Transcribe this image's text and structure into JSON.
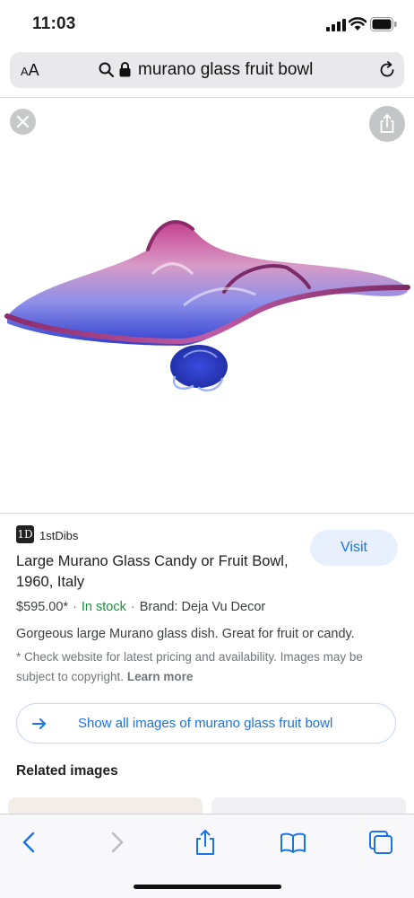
{
  "status": {
    "time": "11:03"
  },
  "address_bar": {
    "aa_label": "AA",
    "url_text": "murano glass fruit bowl"
  },
  "result": {
    "source_logo_text": "1D",
    "source_name": "1stDibs",
    "visit_label": "Visit",
    "title": "Large Murano Glass Candy or Fruit Bowl, 1960, Italy",
    "price": "$595.00*",
    "stock": "In stock",
    "brand": "Brand: Deja Vu Decor",
    "description": "Gorgeous large Murano glass dish. Great for fruit or candy.",
    "disclaimer": "* Check website for latest pricing and availability. Images may be subject to copyright.",
    "learn_more": "Learn more",
    "show_all_label": "Show all images of murano glass fruit bowl",
    "related_heading": "Related images"
  },
  "colors": {
    "accent": "#1a73e8",
    "in_stock": "#1e8e3e",
    "pill_bg": "#e8f0fe"
  },
  "icons": [
    "search-icon",
    "lock-icon",
    "reload-icon",
    "close-icon",
    "share-icon",
    "arrow-right-icon",
    "back-icon",
    "forward-icon",
    "bookmarks-icon",
    "tabs-icon"
  ]
}
